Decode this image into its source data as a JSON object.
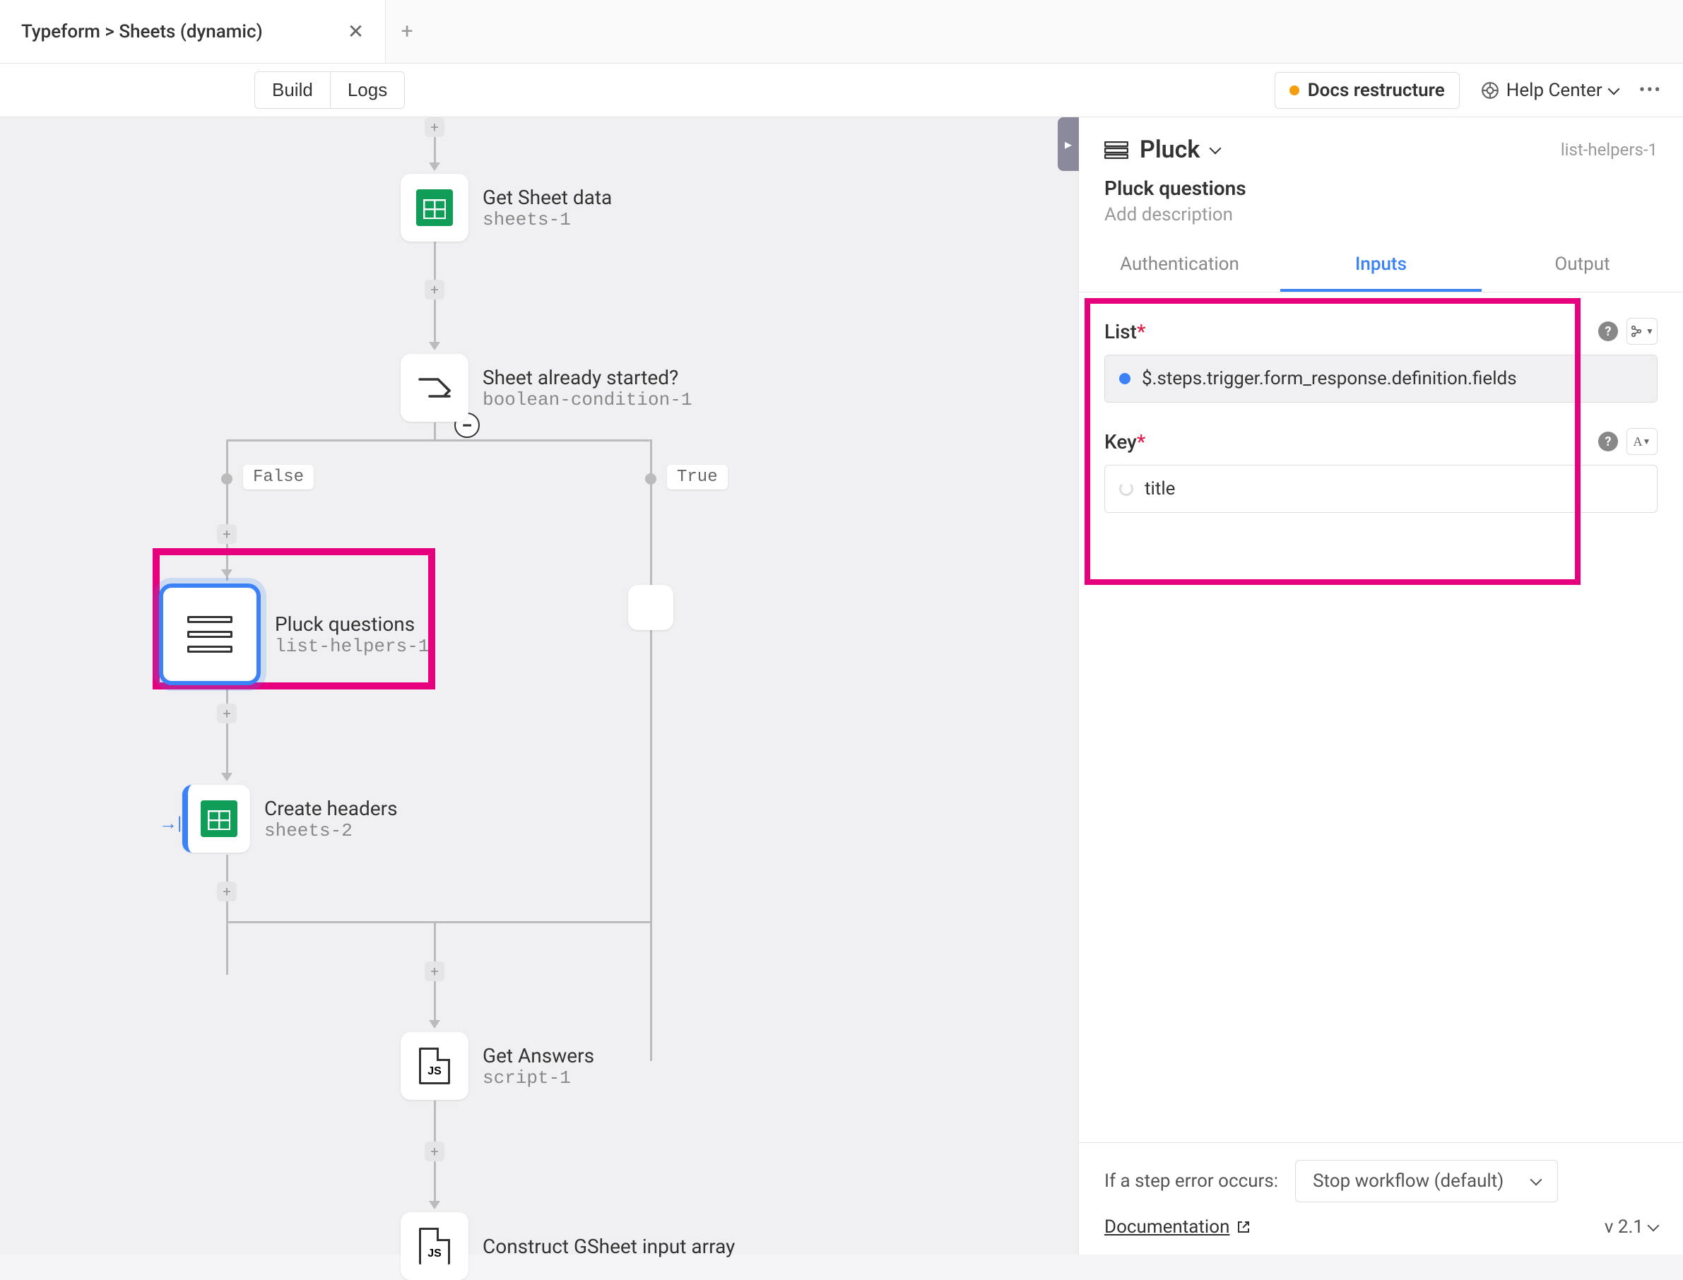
{
  "tab": {
    "title": "Typeform > Sheets (dynamic)"
  },
  "toolbar": {
    "build": "Build",
    "logs": "Logs",
    "docs": "Docs restructure",
    "help": "Help Center"
  },
  "nodes": {
    "sheet": {
      "title": "Get Sheet data",
      "id": "sheets-1"
    },
    "branch": {
      "title": "Sheet already started?",
      "id": "boolean-condition-1"
    },
    "pluck": {
      "title": "Pluck questions",
      "id": "list-helpers-1"
    },
    "headers": {
      "title": "Create headers",
      "id": "sheets-2"
    },
    "answers": {
      "title": "Get Answers",
      "id": "script-1"
    },
    "script2": {
      "title": "Construct GSheet input array",
      "id": ""
    }
  },
  "branches": {
    "false": "False",
    "true": "True"
  },
  "panel": {
    "title": "Pluck",
    "id": "list-helpers-1",
    "subtitle": "Pluck questions",
    "description": "Add description",
    "tabs": {
      "auth": "Authentication",
      "inputs": "Inputs",
      "output": "Output"
    },
    "fields": {
      "list_label": "List",
      "list_value": "$.steps.trigger.form_response.definition.fields",
      "key_label": "Key",
      "key_value": "title"
    },
    "footer": {
      "error_label": "If a step error occurs:",
      "error_value": "Stop workflow (default)",
      "doc_link": "Documentation",
      "version": "v 2.1"
    }
  }
}
